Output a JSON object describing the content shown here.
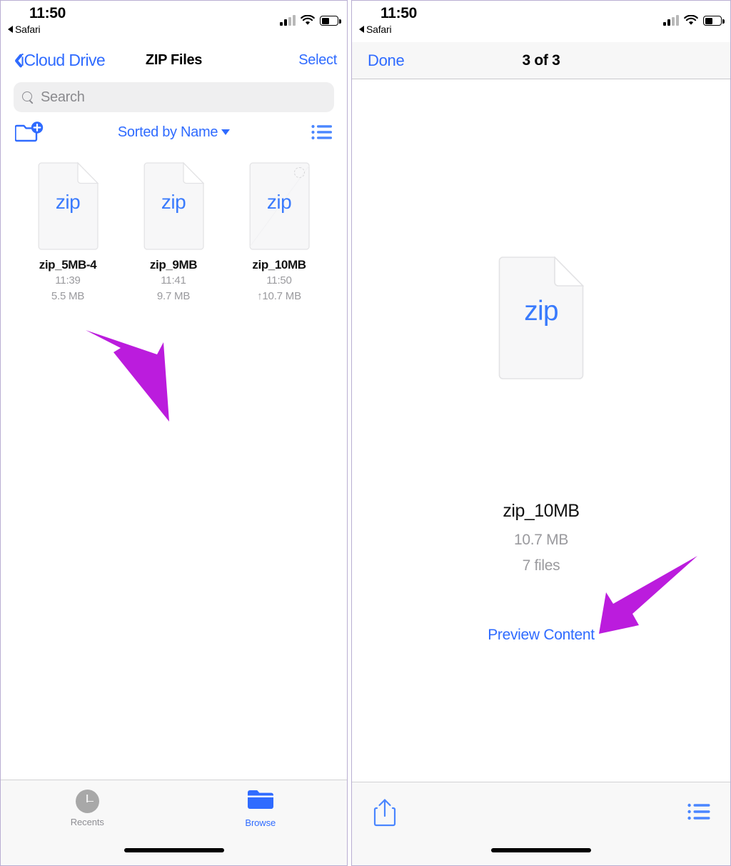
{
  "left": {
    "status": {
      "time": "11:50",
      "back_app": "Safari"
    },
    "nav": {
      "back_label": "iCloud Drive",
      "title": "ZIP Files",
      "action_label": "Select"
    },
    "search": {
      "placeholder": "Search"
    },
    "toolbar": {
      "sort_label": "Sorted by Name"
    },
    "files": [
      {
        "name": "zip_5MB-4",
        "time": "11:39",
        "size": "5.5 MB",
        "type_label": "zip",
        "uploading": false
      },
      {
        "name": "zip_9MB",
        "time": "11:41",
        "size": "9.7 MB",
        "type_label": "zip",
        "uploading": false
      },
      {
        "name": "zip_10MB",
        "time": "11:50",
        "size": "↑10.7 MB",
        "type_label": "zip",
        "uploading": true
      }
    ],
    "tabs": [
      {
        "label": "Recents",
        "icon": "clock-icon",
        "selected": false
      },
      {
        "label": "Browse",
        "icon": "folder-icon",
        "selected": true
      }
    ]
  },
  "right": {
    "status": {
      "time": "11:50",
      "back_app": "Safari"
    },
    "nav": {
      "done_label": "Done",
      "title": "3 of 3"
    },
    "preview": {
      "type_label": "zip",
      "name": "zip_10MB",
      "size": "10.7 MB",
      "file_count": "7 files",
      "preview_link": "Preview Content"
    },
    "bottom": {
      "share_icon": "share-icon",
      "list_icon": "list-view-icon"
    }
  },
  "colors": {
    "accent": "#2f6bff",
    "zip_blue": "#3a7bfd",
    "annotation": "#bb1cdd",
    "muted": "#9a9a9e"
  }
}
